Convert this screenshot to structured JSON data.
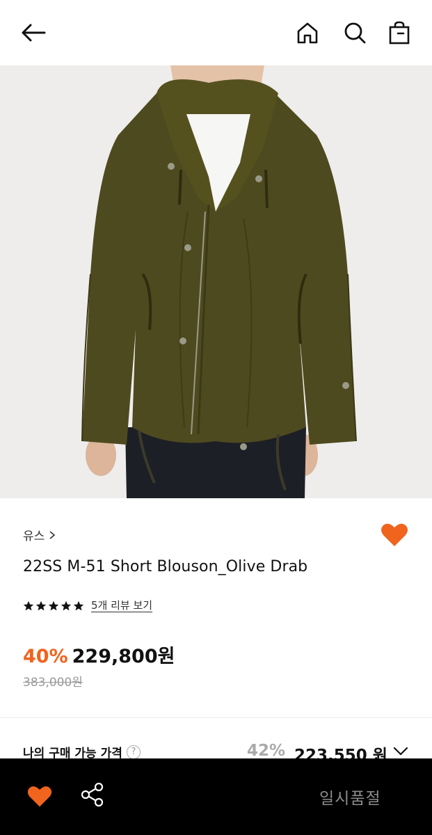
{
  "header": {
    "back_icon": "arrow-left-icon",
    "home_icon": "home-icon",
    "search_icon": "search-icon",
    "bag_icon": "shopping-bag-icon"
  },
  "product": {
    "brand": "유스",
    "brand_chevron": "›",
    "title": "22SS M-51 Short Blouson_Olive Drab",
    "rating_stars": 5,
    "review_link": "5개 리뷰 보기",
    "discount": "40%",
    "price": "229,800원",
    "original_price": "383,000원",
    "wishlisted": true,
    "image_alt": "olive drab hooded jacket worn by model"
  },
  "my_price": {
    "label": "나의 구매 가능 가격",
    "help": "?",
    "discount": "42%",
    "price": "223,550 원"
  },
  "bottom_bar": {
    "status": "일시품절"
  },
  "colors": {
    "accent": "#f0641e",
    "bottom_bar_bg": "#000000",
    "jacket": "#4e4a1f"
  }
}
